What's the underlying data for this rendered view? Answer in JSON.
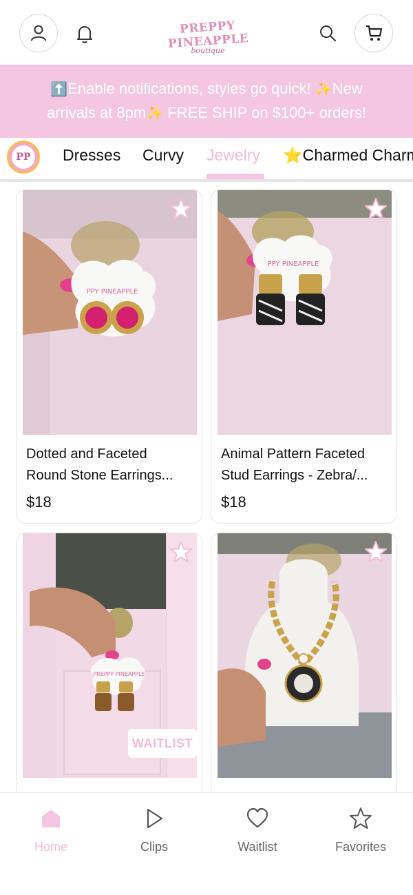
{
  "header": {
    "logo_line1": "PREPPY PINEAPPLE",
    "logo_line2": "boutique",
    "icons": [
      "profile-icon",
      "bell-icon",
      "search-icon",
      "cart-icon"
    ]
  },
  "banner": {
    "line1_icon": "⬆️",
    "line1_text": "Enable notifications, styles go quick! ",
    "line1_emoji": "✨",
    "line1_text2": "New",
    "line2_text": "arrivals at 8pm",
    "line2_emoji": "✨",
    "line2_text2": " FREE SHIP on $100+ orders!"
  },
  "tabs": {
    "badge": "PP",
    "items": [
      {
        "label": "Dresses",
        "active": false
      },
      {
        "label": "Curvy",
        "active": false
      },
      {
        "label": "Jewelry",
        "active": true
      },
      {
        "label": "⭐Charmed Charms",
        "active": false
      }
    ]
  },
  "products": [
    {
      "title_line1": "Dotted and Faceted",
      "title_line2": "Round Stone Earrings...",
      "price": "$18",
      "photo_sign": "PPY PINEAPPLE"
    },
    {
      "title_line1": "Animal Pattern Faceted",
      "title_line2": "Stud Earrings - Zebra/...",
      "price": "$18",
      "photo_sign": "PPY PINEAPPLE"
    },
    {
      "tag": "WAITLIST",
      "photo_sign": "PREPPY PINEAPPLE"
    },
    {}
  ],
  "nav": {
    "items": [
      {
        "label": "Home",
        "icon": "home-icon",
        "active": true
      },
      {
        "label": "Clips",
        "icon": "play-icon",
        "active": false
      },
      {
        "label": "Waitlist",
        "icon": "heart-icon",
        "active": false
      },
      {
        "label": "Favorites",
        "icon": "star-icon",
        "active": false
      }
    ]
  },
  "colors": {
    "accent_pink": "#f5c6e2",
    "active_text": "#f3bcd9",
    "border": "#e3e3e3"
  }
}
